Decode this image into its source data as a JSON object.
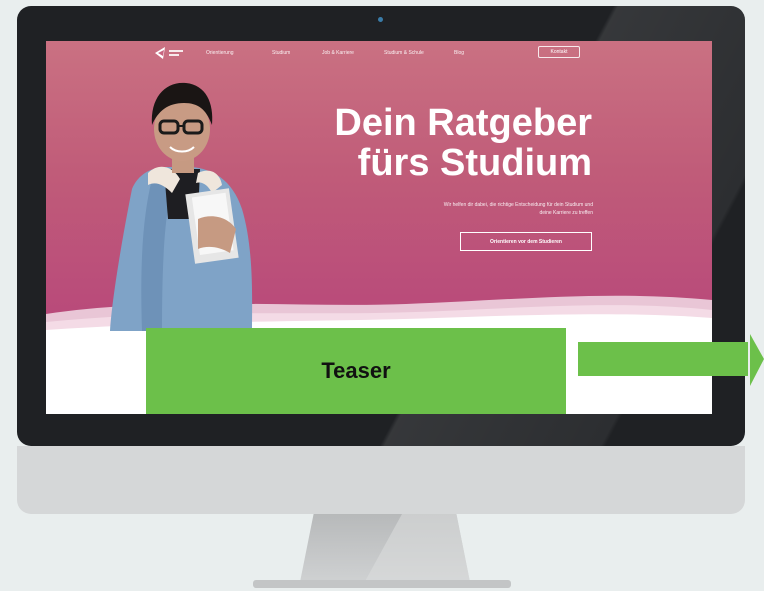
{
  "website": {
    "nav": {
      "items": [
        "Orientierung",
        "Studium",
        "Job & Karriere",
        "Studium & Schule",
        "Blog"
      ],
      "button_label": "Kontakt"
    },
    "hero": {
      "headline_line1": "Dein Ratgeber",
      "headline_line2": "fürs Studium",
      "subtext_line1": "Wir helfen dir dabei, die richtige Entscheidung für dein Studium und",
      "subtext_line2": "deine Karriere zu treffen",
      "cta_label": "Orientieren vor dem Studieren"
    }
  },
  "overlay": {
    "teaser_label": "Teaser"
  },
  "colors": {
    "hero_top": "#ca7182",
    "hero_bottom": "#b8487a",
    "teaser_green": "#6cc04a",
    "bezel": "#1f2124",
    "background": "#e9eeee"
  },
  "icons": {
    "logo": "site-logo-icon",
    "arrow": "arrow-right-icon"
  }
}
